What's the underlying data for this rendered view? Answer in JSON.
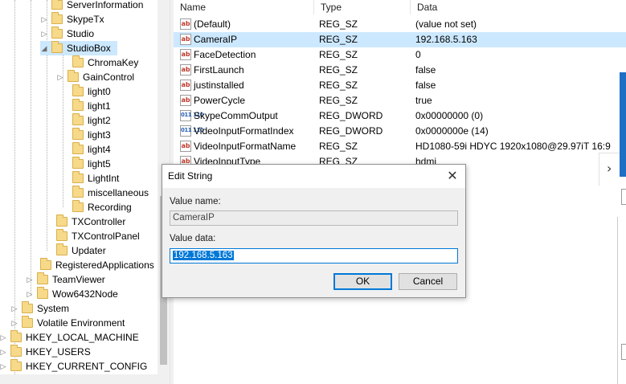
{
  "tree": {
    "items": [
      {
        "label": "ServerInformation"
      },
      {
        "label": "SkypeTx"
      },
      {
        "label": "Studio"
      },
      {
        "label": "StudioBox"
      },
      {
        "label": "ChromaKey"
      },
      {
        "label": "GainControl"
      },
      {
        "label": "light0"
      },
      {
        "label": "light1"
      },
      {
        "label": "light2"
      },
      {
        "label": "light3"
      },
      {
        "label": "light4"
      },
      {
        "label": "light5"
      },
      {
        "label": "LightInt"
      },
      {
        "label": "miscellaneous"
      },
      {
        "label": "Recording"
      },
      {
        "label": "TXController"
      },
      {
        "label": "TXControlPanel"
      },
      {
        "label": "Updater"
      },
      {
        "label": "RegisteredApplications"
      },
      {
        "label": "TeamViewer"
      },
      {
        "label": "Wow6432Node"
      },
      {
        "label": "System"
      },
      {
        "label": "Volatile Environment"
      },
      {
        "label": "HKEY_LOCAL_MACHINE"
      },
      {
        "label": "HKEY_USERS"
      },
      {
        "label": "HKEY_CURRENT_CONFIG"
      }
    ]
  },
  "values": {
    "headers": {
      "name": "Name",
      "type": "Type",
      "data": "Data"
    },
    "rows": [
      {
        "name": "(Default)",
        "type": "REG_SZ",
        "data": "(value not set)",
        "icon": "string-value-icon"
      },
      {
        "name": "CameraIP",
        "type": "REG_SZ",
        "data": "192.168.5.163",
        "icon": "string-value-icon"
      },
      {
        "name": "FaceDetection",
        "type": "REG_SZ",
        "data": "0",
        "icon": "string-value-icon"
      },
      {
        "name": "FirstLaunch",
        "type": "REG_SZ",
        "data": "false",
        "icon": "string-value-icon"
      },
      {
        "name": "justinstalled",
        "type": "REG_SZ",
        "data": "false",
        "icon": "string-value-icon"
      },
      {
        "name": "PowerCycle",
        "type": "REG_SZ",
        "data": "true",
        "icon": "string-value-icon"
      },
      {
        "name": "SkypeCommOutput",
        "type": "REG_DWORD",
        "data": "0x00000000 (0)",
        "icon": "dword-value-icon"
      },
      {
        "name": "VideoInputFormatIndex",
        "type": "REG_DWORD",
        "data": "0x0000000e (14)",
        "icon": "dword-value-icon"
      },
      {
        "name": "VideoInputFormatName",
        "type": "REG_SZ",
        "data": "HD1080-59i HDYC 1920x1080@29.97iT 16:9",
        "icon": "string-value-icon"
      },
      {
        "name": "VideoInputType",
        "type": "REG_SZ",
        "data": "hdmi",
        "icon": "string-value-icon"
      }
    ],
    "string_icon_text": "ab",
    "dword_icon_text": "011 110"
  },
  "dialog": {
    "title": "Edit String",
    "value_name_label": "Value name:",
    "value_name": "CameraIP",
    "value_data_label": "Value data:",
    "value_data": "192.168.5.163",
    "ok_label": "OK",
    "cancel_label": "Cancel"
  },
  "colors": {
    "selection": "#cce8ff",
    "accent": "#0078d7",
    "folder": "#f7d98a"
  }
}
